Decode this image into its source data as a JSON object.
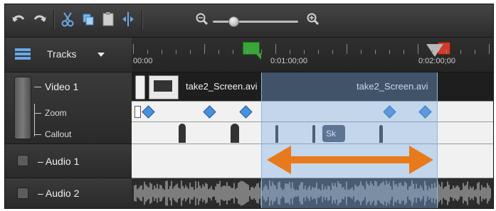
{
  "toolbar": {
    "icons": [
      "undo-icon",
      "redo-icon",
      "cut-icon",
      "copy-icon",
      "paste-icon",
      "split-icon",
      "zoom-out-icon",
      "zoom-in-icon"
    ],
    "zoom_level": 0.22
  },
  "tracks_header": {
    "label": "Tracks"
  },
  "ruler": {
    "times": [
      "00:00",
      "0:01:00;00",
      "0:02:00;00"
    ]
  },
  "tracks": {
    "video": {
      "label": "Video 1",
      "clip1": "take2_Screen.avi",
      "clip2": "take2_Screen.avi"
    },
    "zoom": {
      "label": "Zoom"
    },
    "callout": {
      "label": "Callout",
      "text": "Sk"
    },
    "audio1": {
      "label": "Audio 1"
    },
    "audio2": {
      "label": "Audio 2"
    }
  },
  "colors": {
    "selection": "#78aae6",
    "arrow": "#e87a1c",
    "keyframe": "#4a90d9",
    "start_marker": "#3aa53a",
    "end_marker": "#d23a2a"
  }
}
